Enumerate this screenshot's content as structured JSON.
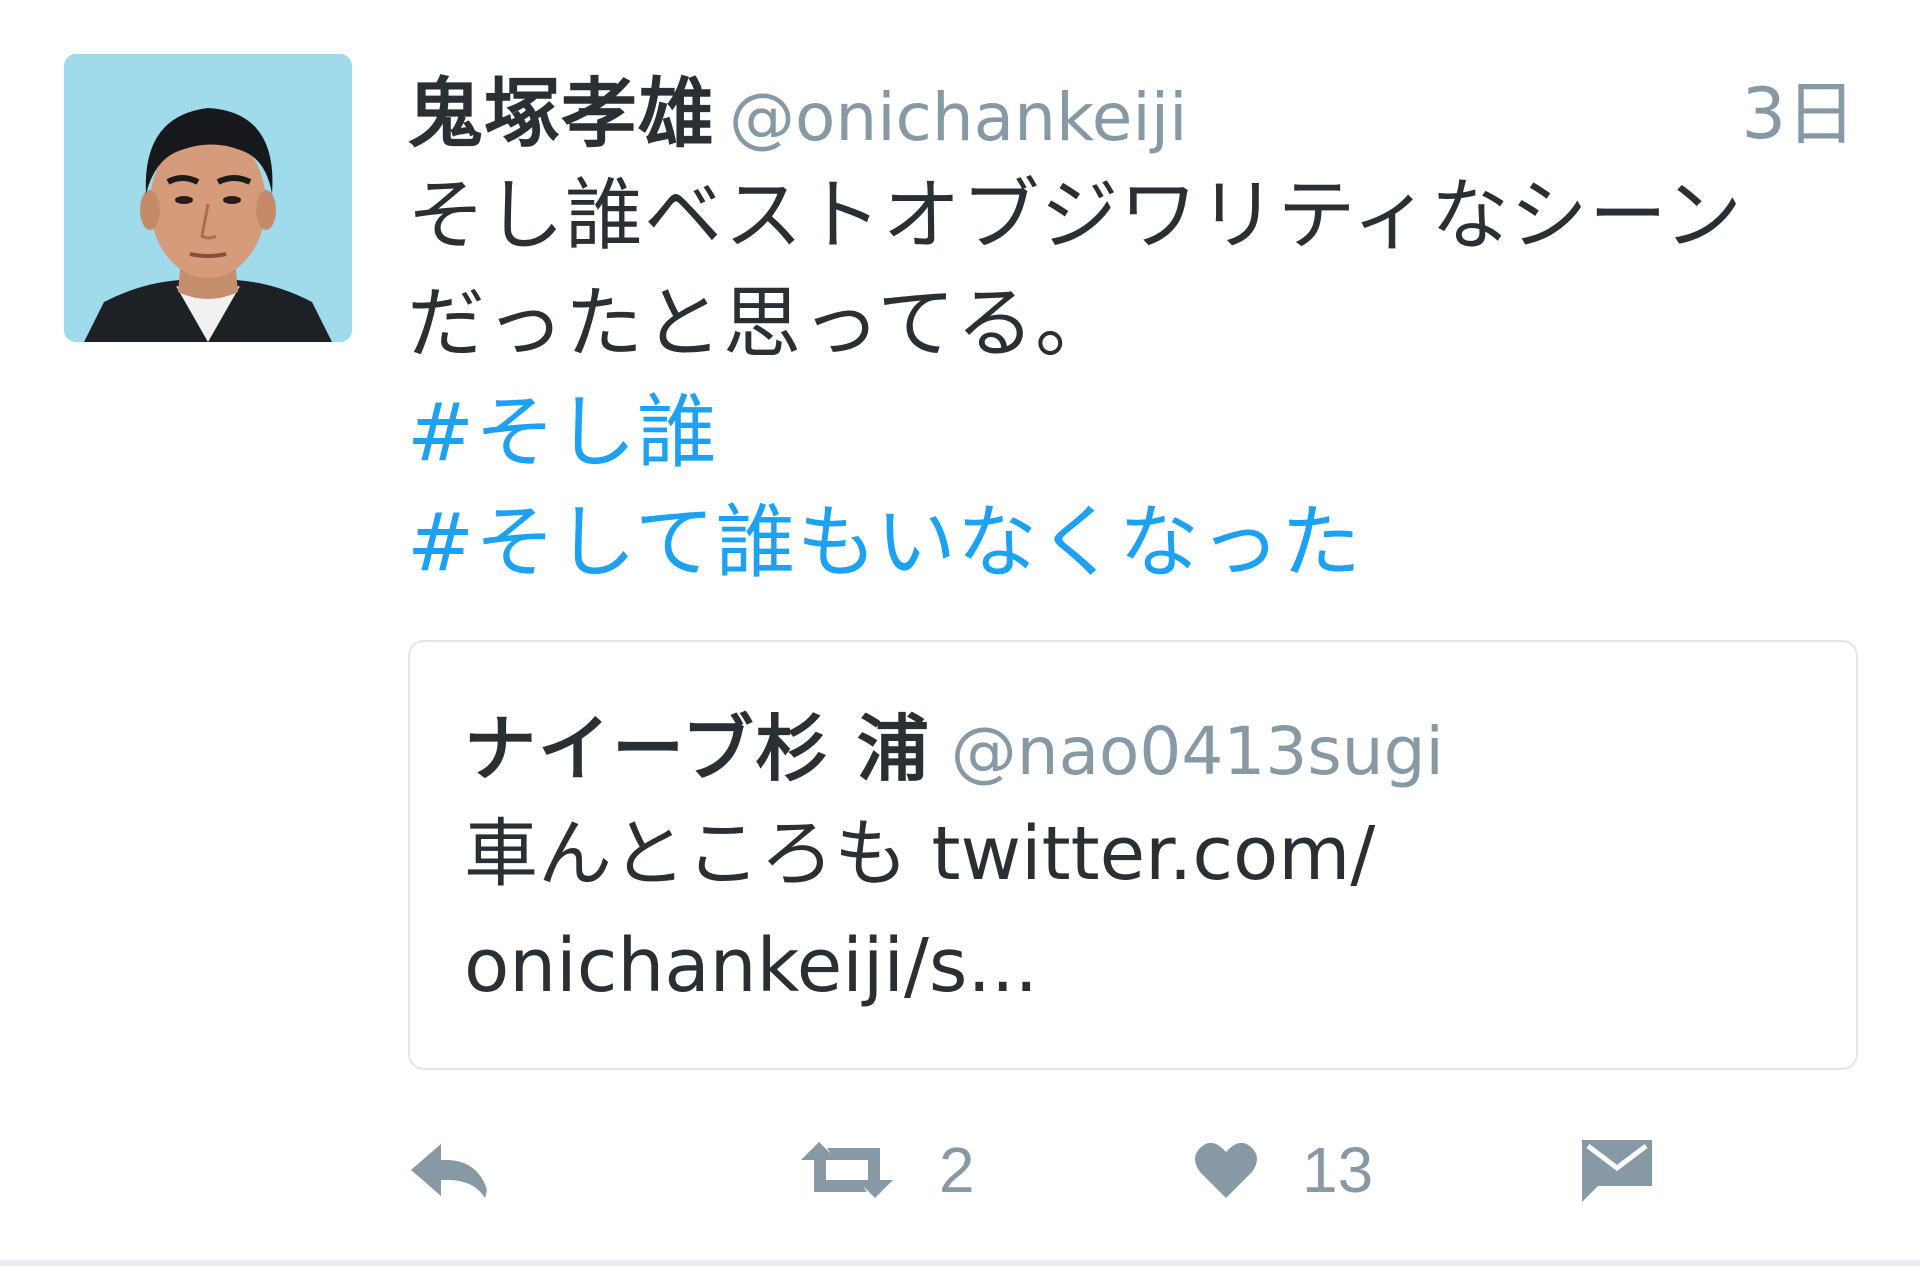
{
  "tweet": {
    "author": {
      "display_name": "鬼塚孝雄",
      "screen_name": "@onichankeiji"
    },
    "timestamp": "3日",
    "text_lines": [
      "そし誰ベストオブジワリティなシーン",
      "だったと思ってる。"
    ],
    "hashtags": [
      "#そし誰",
      "#そして誰もいなくなった"
    ],
    "quoted": {
      "display_name": "ナイーブ杉 浦",
      "screen_name": "@nao0413sugi",
      "text_lines": [
        "車んところも twitter.com/",
        "onichankeiji/s..."
      ]
    },
    "actions": {
      "retweet_count": "2",
      "like_count": "13"
    },
    "icons": {
      "reply": "reply-icon",
      "retweet": "retweet-icon",
      "like": "heart-icon",
      "dm": "envelope-icon"
    },
    "colors": {
      "link": "#1da1f2",
      "muted": "#8899a6",
      "text": "#292f33",
      "avatar_bg": "#9fdbea"
    }
  }
}
